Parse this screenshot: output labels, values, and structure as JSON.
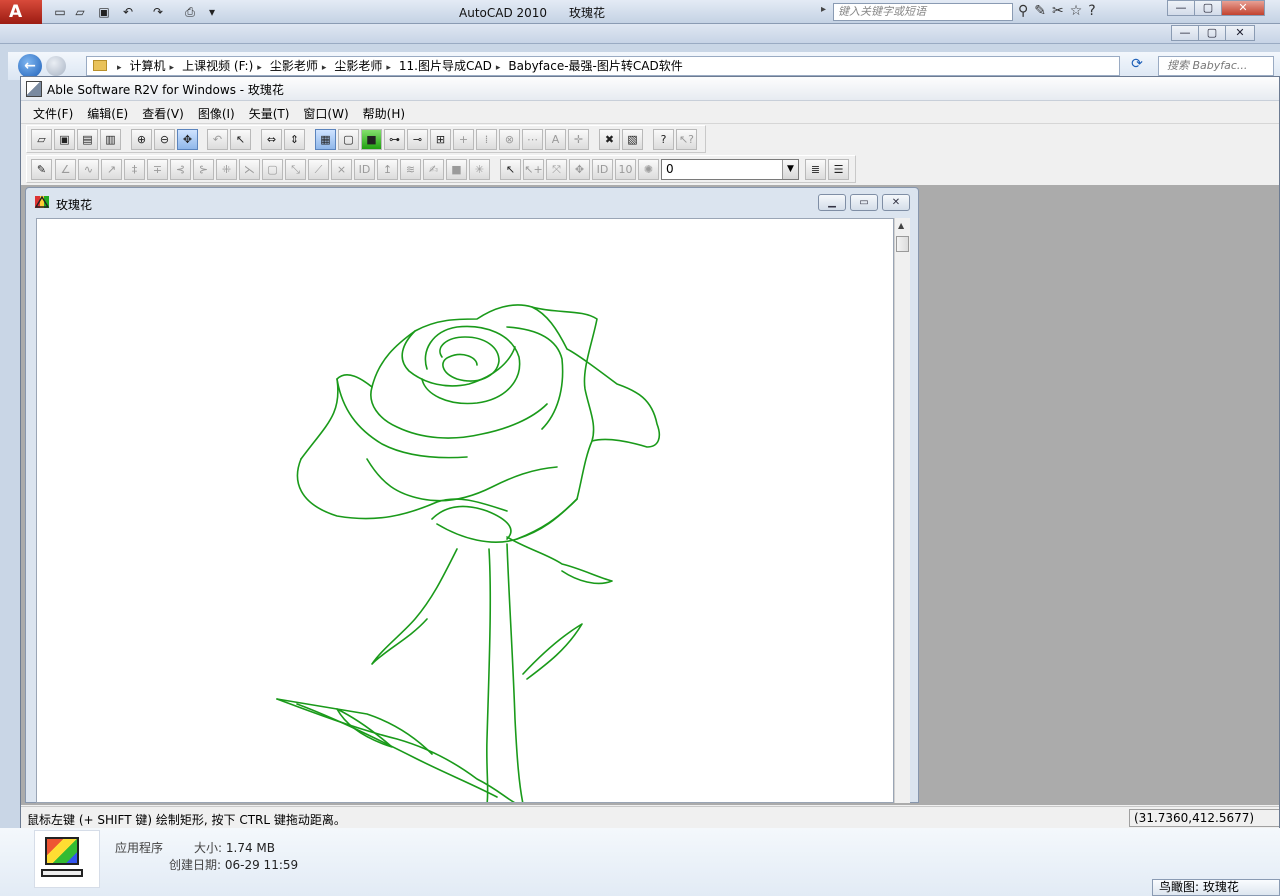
{
  "autocad": {
    "app_name": "AutoCAD 2010",
    "doc_name": "玫瑰花",
    "search_placeholder": "键入关键字或短语"
  },
  "explorer": {
    "breadcrumbs": [
      "计算机",
      "上课视频 (F:)",
      "尘影老师",
      "尘影老师",
      "11.图片导成CAD",
      "Babyface-最强-图片转CAD软件"
    ],
    "search_placeholder": "搜索 Babyfac..."
  },
  "r2v": {
    "title": "Able Software R2V for Windows - 玫瑰花",
    "menu": [
      "文件(F)",
      "编辑(E)",
      "查看(V)",
      "图像(I)",
      "矢量(T)",
      "窗口(W)",
      "帮助(H)"
    ],
    "layer_value": "0",
    "child_title": "玫瑰花",
    "status_message": "鼠标左键 (+ SHIFT 键) 绘制矩形, 按下 CTRL 键拖动距离。",
    "coordinates": "(31.7360,412.5677)",
    "line_color": "#1a9a1a"
  },
  "details": {
    "type": "应用程序",
    "size_label": "大小:",
    "size_value": "1.74 MB",
    "date_label": "创建日期:",
    "date_value": "06-29 11:59"
  },
  "birdseye": {
    "title": "鸟瞰图: 玫瑰花"
  }
}
